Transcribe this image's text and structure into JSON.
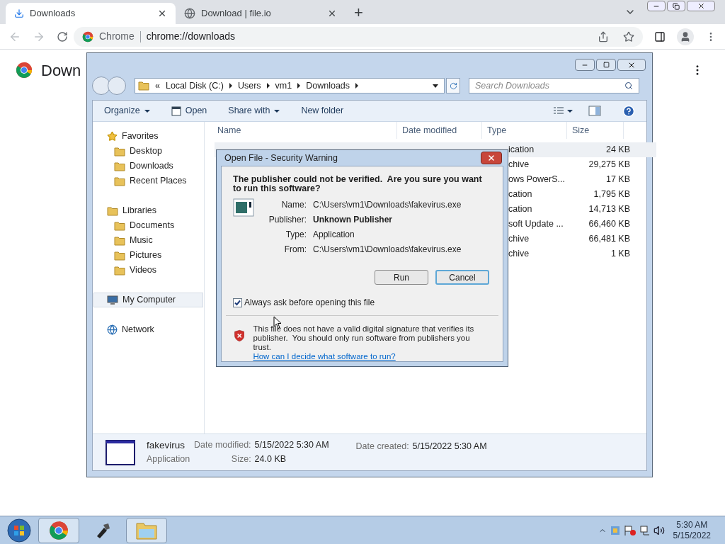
{
  "browser": {
    "tabs": [
      {
        "title": "Downloads",
        "selected": true
      },
      {
        "title": "Download | file.io",
        "selected": false
      }
    ],
    "new_tab": "+",
    "address": {
      "site_label": "Chrome",
      "url": "chrome://downloads"
    },
    "page_title": "Down"
  },
  "explorer": {
    "breadcrumb": [
      "«",
      "Local Disk (C:)",
      "Users",
      "vm1",
      "Downloads"
    ],
    "search_placeholder": "Search Downloads",
    "toolbar": [
      {
        "label": "Organize",
        "dropdown": true
      },
      {
        "label": "Open",
        "dropdown": false
      },
      {
        "label": "Share with",
        "dropdown": true
      },
      {
        "label": "New folder",
        "dropdown": false
      }
    ],
    "sidebar": [
      {
        "label": "Favorites",
        "selected": false,
        "children": [
          {
            "label": "Desktop"
          },
          {
            "label": "Downloads"
          },
          {
            "label": "Recent Places"
          }
        ]
      },
      {
        "label": "Libraries",
        "selected": false,
        "children": [
          {
            "label": "Documents"
          },
          {
            "label": "Music"
          },
          {
            "label": "Pictures"
          },
          {
            "label": "Videos"
          }
        ]
      },
      {
        "label": "My Computer",
        "selected": true
      },
      {
        "label": "Network",
        "selected": false
      }
    ],
    "columns": [
      "Name",
      "Date modified",
      "Type",
      "Size"
    ],
    "rows": [
      {
        "type": "ication",
        "size": "24 KB",
        "selected": true
      },
      {
        "type": "chive",
        "size": "29,275 KB",
        "selected": false
      },
      {
        "type": "ows PowerS...",
        "size": "17 KB",
        "selected": false
      },
      {
        "type": "cation",
        "size": "1,795 KB",
        "selected": false
      },
      {
        "type": "cation",
        "size": "14,713 KB",
        "selected": false
      },
      {
        "type": "soft Update ...",
        "size": "66,460 KB",
        "selected": false
      },
      {
        "type": "chive",
        "size": "66,481 KB",
        "selected": false
      },
      {
        "type": "chive",
        "size": "1 KB",
        "selected": false
      }
    ],
    "details": {
      "name": "fakevirus",
      "kind": "Application",
      "fields": [
        {
          "label": "Date modified:",
          "value": "5/15/2022 5:30 AM"
        },
        {
          "label": "Size:",
          "value": "24.0 KB"
        },
        {
          "label": "Date created:",
          "value": "5/15/2022 5:30 AM"
        }
      ]
    }
  },
  "dialog": {
    "title": "Open File - Security Warning",
    "heading": "The publisher could not be verified.  Are you sure you want to run this software?",
    "fields": [
      {
        "label": "Name:",
        "value": "C:\\Users\\vm1\\Downloads\\fakevirus.exe",
        "emphasized": false
      },
      {
        "label": "Publisher:",
        "value": "Unknown Publisher",
        "emphasized": true
      },
      {
        "label": "Type:",
        "value": "Application",
        "emphasized": false
      },
      {
        "label": "From:",
        "value": "C:\\Users\\vm1\\Downloads\\fakevirus.exe",
        "emphasized": false
      }
    ],
    "buttons": [
      {
        "label": "Run",
        "default": false
      },
      {
        "label": "Cancel",
        "default": true
      }
    ],
    "checkbox": {
      "label": "Always ask before opening this file",
      "checked": true
    },
    "warning": "This file does not have a valid digital signature that verifies its publisher.  You should only run software from publishers you trust.",
    "link": "How can I decide what software to run?"
  },
  "taskbar": {
    "apps": [
      {
        "kind": "chrome",
        "running": true
      },
      {
        "kind": "tool",
        "running": false
      },
      {
        "kind": "folder",
        "running": true
      }
    ],
    "time": "5:30 AM",
    "date": "5/15/2022"
  }
}
